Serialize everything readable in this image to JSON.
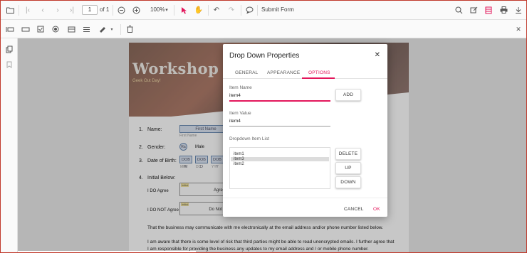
{
  "toolbar": {
    "page_value": "1",
    "page_of": "of 1",
    "zoom": "100%",
    "submit_form": "Submit Form"
  },
  "page": {
    "workshop_title": "Workshop",
    "tagline": "Geek Out Day!",
    "q1_num": "1.",
    "q1_label": "Name:",
    "first_name_field": "First Name",
    "first_name_hint": "First Name",
    "q2_num": "2.",
    "q2_label": "Gender:",
    "gender_radio_text": "Ra",
    "gender_male": "Male",
    "q3_num": "3.",
    "q3_label": "Date of Birth:",
    "dob_mm": "DOB M",
    "dob_dd": "DOB D",
    "dob_yy": "DOB Y",
    "dob_mm_hint": "MM",
    "dob_dd_hint": "DD",
    "dob_yy_hint": "YY",
    "q4_num": "4.",
    "q4_label": "Initial Below:",
    "i_do_agree": "I DO Agree",
    "i_do_not_agree": "I DO NOT Agree",
    "initial_tag": "Initial",
    "agree_field": "Agree",
    "do_not_agree_field": "Do Not Agr",
    "para1": "That the business may communicate with me electronically at the email address and/or phone number listed below.",
    "para2_line1": "I am aware that there is some level of risk that third parties might be able to read unencrypted emails. I further agree that",
    "para2_line2": "I am responsible for providing the business any updates to my email address and / or mobile phone number."
  },
  "dialog": {
    "title": "Drop Down Properties",
    "tabs": [
      "GENERAL",
      "APPEARANCE",
      "OPTIONS"
    ],
    "active_tab": "OPTIONS",
    "item_name_label": "Item Name",
    "item_name_value": "item4",
    "add_label": "ADD",
    "item_value_label": "Item Value",
    "item_value_value": "item4",
    "list_label": "Dropdown Item List",
    "list_items": [
      "item1",
      "item3",
      "item2"
    ],
    "selected_item": "item3",
    "delete_label": "DELETE",
    "up_label": "UP",
    "down_label": "DOWN",
    "cancel_label": "CANCEL",
    "ok_label": "OK",
    "accent_color": "#e3165b"
  },
  "icons": [
    "folder-icon",
    "first-page-icon",
    "prev-page-icon",
    "next-page-icon",
    "last-page-icon",
    "zoom-out-icon",
    "zoom-in-icon",
    "select-cursor-icon",
    "pan-hand-icon",
    "undo-icon",
    "redo-icon",
    "comment-icon",
    "search-icon",
    "annotation-icon",
    "form-designer-icon",
    "print-icon",
    "download-icon",
    "close-icon"
  ]
}
